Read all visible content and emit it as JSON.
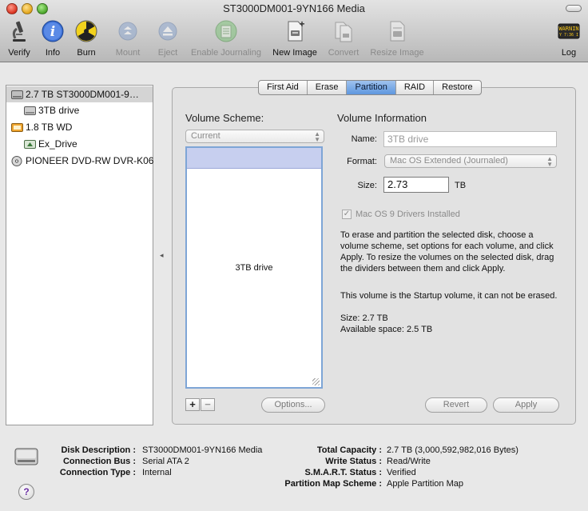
{
  "window": {
    "title": "ST3000DM001-9YN166 Media"
  },
  "toolbar": {
    "verify": "Verify",
    "info": "Info",
    "burn": "Burn",
    "mount": "Mount",
    "eject": "Eject",
    "enable_journaling": "Enable Journaling",
    "new_image": "New Image",
    "convert": "Convert",
    "resize_image": "Resize Image",
    "log": "Log",
    "log_badge": "WARNIN"
  },
  "sidebar": {
    "items": [
      {
        "label": "2.7 TB ST3000DM001-9…",
        "icon": "internal-disk-icon",
        "selected": true
      },
      {
        "label": "3TB drive",
        "icon": "volume-icon"
      },
      {
        "label": "1.8 TB WD",
        "icon": "external-disk-icon"
      },
      {
        "label": "Ex_Drive",
        "icon": "external-volume-icon"
      },
      {
        "label": "PIONEER DVD-RW DVR-K06",
        "icon": "optical-drive-icon"
      }
    ]
  },
  "tabs": [
    "First Aid",
    "Erase",
    "Partition",
    "RAID",
    "Restore"
  ],
  "active_tab": "Partition",
  "partition": {
    "scheme_title": "Volume Scheme:",
    "scheme_value": "Current",
    "volume_name": "3TB drive",
    "add_label": "+",
    "remove_label": "−",
    "options_label": "Options...",
    "info_title": "Volume Information",
    "name_label": "Name:",
    "name_value": "3TB drive",
    "format_label": "Format:",
    "format_value": "Mac OS Extended (Journaled)",
    "size_label": "Size:",
    "size_value": "2.73",
    "size_unit": "TB",
    "os9_label": "Mac OS 9 Drivers Installed",
    "instructions": "To erase and partition the selected disk, choose a volume scheme, set options for each volume, and click Apply. To resize the volumes on the selected disk, drag the dividers between them and click Apply.",
    "startup_note": "This volume is the Startup volume, it can not be erased.",
    "size_line": "Size: 2.7 TB",
    "available_line": "Available space: 2.5 TB",
    "revert_label": "Revert",
    "apply_label": "Apply"
  },
  "footer": {
    "disk_description_label": "Disk Description :",
    "disk_description_value": "ST3000DM001-9YN166 Media",
    "connection_bus_label": "Connection Bus :",
    "connection_bus_value": "Serial ATA 2",
    "connection_type_label": "Connection Type :",
    "connection_type_value": "Internal",
    "total_capacity_label": "Total Capacity :",
    "total_capacity_value": "2.7 TB (3,000,592,982,016 Bytes)",
    "write_status_label": "Write Status :",
    "write_status_value": "Read/Write",
    "smart_status_label": "S.M.A.R.T. Status :",
    "smart_status_value": "Verified",
    "partition_map_label": "Partition Map Scheme :",
    "partition_map_value": "Apple Partition Map",
    "help_label": "?"
  },
  "colors": {
    "tab_active": "#6fa2e4",
    "scheme_selection": "#c7cfef",
    "scheme_border": "#7ea5d6"
  }
}
